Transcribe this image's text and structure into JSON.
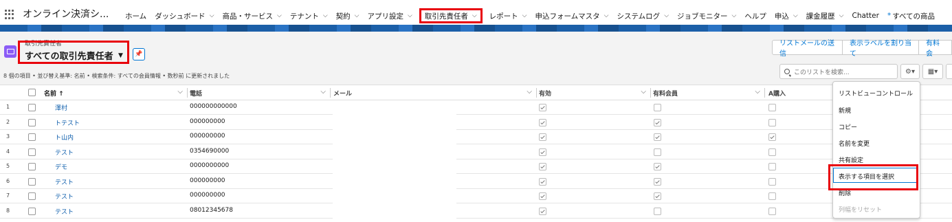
{
  "app": {
    "name": "オンライン決済シ..."
  },
  "nav": {
    "items": [
      {
        "label": "ホーム",
        "chev": false
      },
      {
        "label": "ダッシュボード",
        "chev": true
      },
      {
        "label": "商品・サービス",
        "chev": true
      },
      {
        "label": "テナント",
        "chev": true
      },
      {
        "label": "契約",
        "chev": true
      },
      {
        "label": "アプリ設定",
        "chev": true
      },
      {
        "label": "取引先責任者",
        "chev": true,
        "active": true
      },
      {
        "label": "レポート",
        "chev": true
      },
      {
        "label": "申込フォームマスタ",
        "chev": true
      },
      {
        "label": "システムログ",
        "chev": true
      },
      {
        "label": "ジョブモニター",
        "chev": true
      },
      {
        "label": "ヘルプ",
        "chev": false
      },
      {
        "label": "申込",
        "chev": true
      },
      {
        "label": "課金履歴",
        "chev": true
      },
      {
        "label": "Chatter",
        "chev": false
      },
      {
        "label": "すべての商品",
        "chev": false,
        "star": true
      }
    ]
  },
  "header": {
    "object_label": "取引先責任者",
    "list_title": "すべての取引先責任者",
    "subtitle": "8 個の項目 • 並び替え基準: 名前 • 検索条件: すべての会員情報 • 数秒前 に更新されました",
    "buttons": [
      "リストメールの送信",
      "表示ラベルを割り当て",
      "有料会"
    ],
    "search_placeholder": "このリストを検索..."
  },
  "table": {
    "columns": [
      "名前 ↑",
      "電話",
      "メール",
      "有効",
      "有料会員",
      "A購入"
    ],
    "rows": [
      {
        "num": "1",
        "name": "澤村",
        "phone": "000000000000",
        "active": true,
        "paid": false,
        "a": false
      },
      {
        "num": "2",
        "name": "トテスト",
        "phone": "000000000",
        "active": true,
        "paid": true,
        "a": false
      },
      {
        "num": "3",
        "name": "ト山内",
        "phone": "000000000",
        "active": true,
        "paid": true,
        "a": true
      },
      {
        "num": "4",
        "name": "テスト",
        "phone": "0354690000",
        "active": true,
        "paid": false,
        "a": false
      },
      {
        "num": "5",
        "name": "デモ",
        "phone": "0000000000",
        "active": true,
        "paid": true,
        "a": false
      },
      {
        "num": "6",
        "name": "テスト",
        "phone": "000000000",
        "active": true,
        "paid": true,
        "a": false
      },
      {
        "num": "7",
        "name": "テスト",
        "phone": "000000000",
        "active": true,
        "paid": true,
        "a": false
      },
      {
        "num": "8",
        "name": "テスト",
        "phone": "08012345678",
        "active": true,
        "paid": false,
        "a": false
      }
    ]
  },
  "menu": {
    "items": [
      {
        "label": "リストビューコントロール",
        "disabled": false
      },
      {
        "label": "新規",
        "disabled": false
      },
      {
        "label": "コピー",
        "disabled": false
      },
      {
        "label": "名前を変更",
        "disabled": false
      },
      {
        "label": "共有設定",
        "disabled": false
      },
      {
        "label": "表示する項目を選択",
        "disabled": false
      },
      {
        "label": "削除",
        "disabled": false
      },
      {
        "label": "列幅をリセット",
        "disabled": true
      }
    ]
  },
  "icons": {
    "pin": "pin-icon",
    "gear": "gear-icon",
    "table_view": "table-icon",
    "search": "search-icon"
  },
  "colors": {
    "highlight": "#e8000b",
    "link": "#0b5cab",
    "brand": "#0176d3"
  }
}
